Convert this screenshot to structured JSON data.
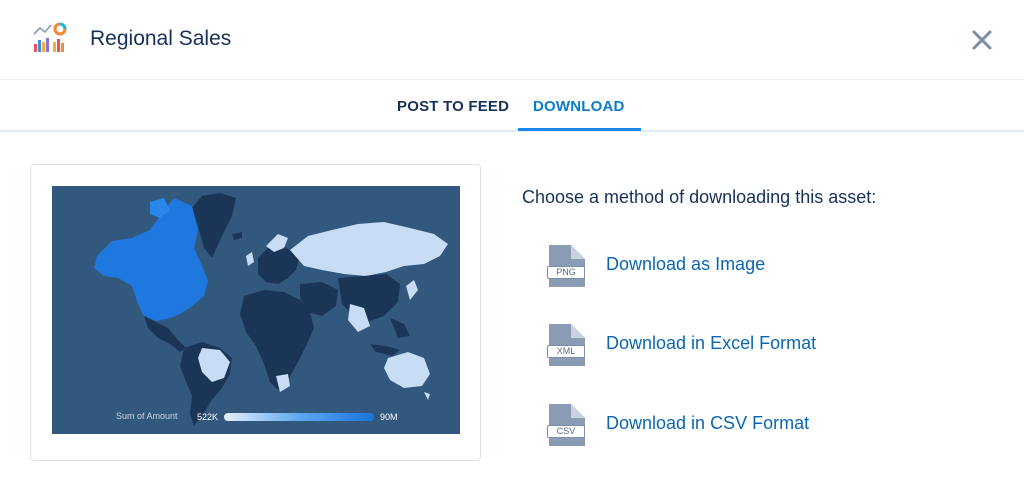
{
  "header": {
    "title": "Regional Sales",
    "app_icon": "dashboard-chart-icon",
    "close_icon": "close-icon"
  },
  "tabs": [
    {
      "label": "POST TO FEED",
      "active": false
    },
    {
      "label": "DOWNLOAD",
      "active": true
    }
  ],
  "preview": {
    "legend_title": "Sum of Amount",
    "legend_min": "522K",
    "legend_max": "90M"
  },
  "download": {
    "instructions": "Choose a method of downloading this asset:",
    "options": [
      {
        "ext": "PNG",
        "label": "Download as Image",
        "icon": "file-png-icon"
      },
      {
        "ext": "XML",
        "label": "Download in Excel Format",
        "icon": "file-xml-icon"
      },
      {
        "ext": "CSV",
        "label": "Download in CSV Format",
        "icon": "file-csv-icon"
      }
    ]
  },
  "colors": {
    "accent": "#1589ee",
    "link": "#0b66b0",
    "map_background": "#33587e",
    "map_dark": "#1b3556",
    "map_light": "#c7dcf5",
    "map_bright": "#1f78e0"
  }
}
